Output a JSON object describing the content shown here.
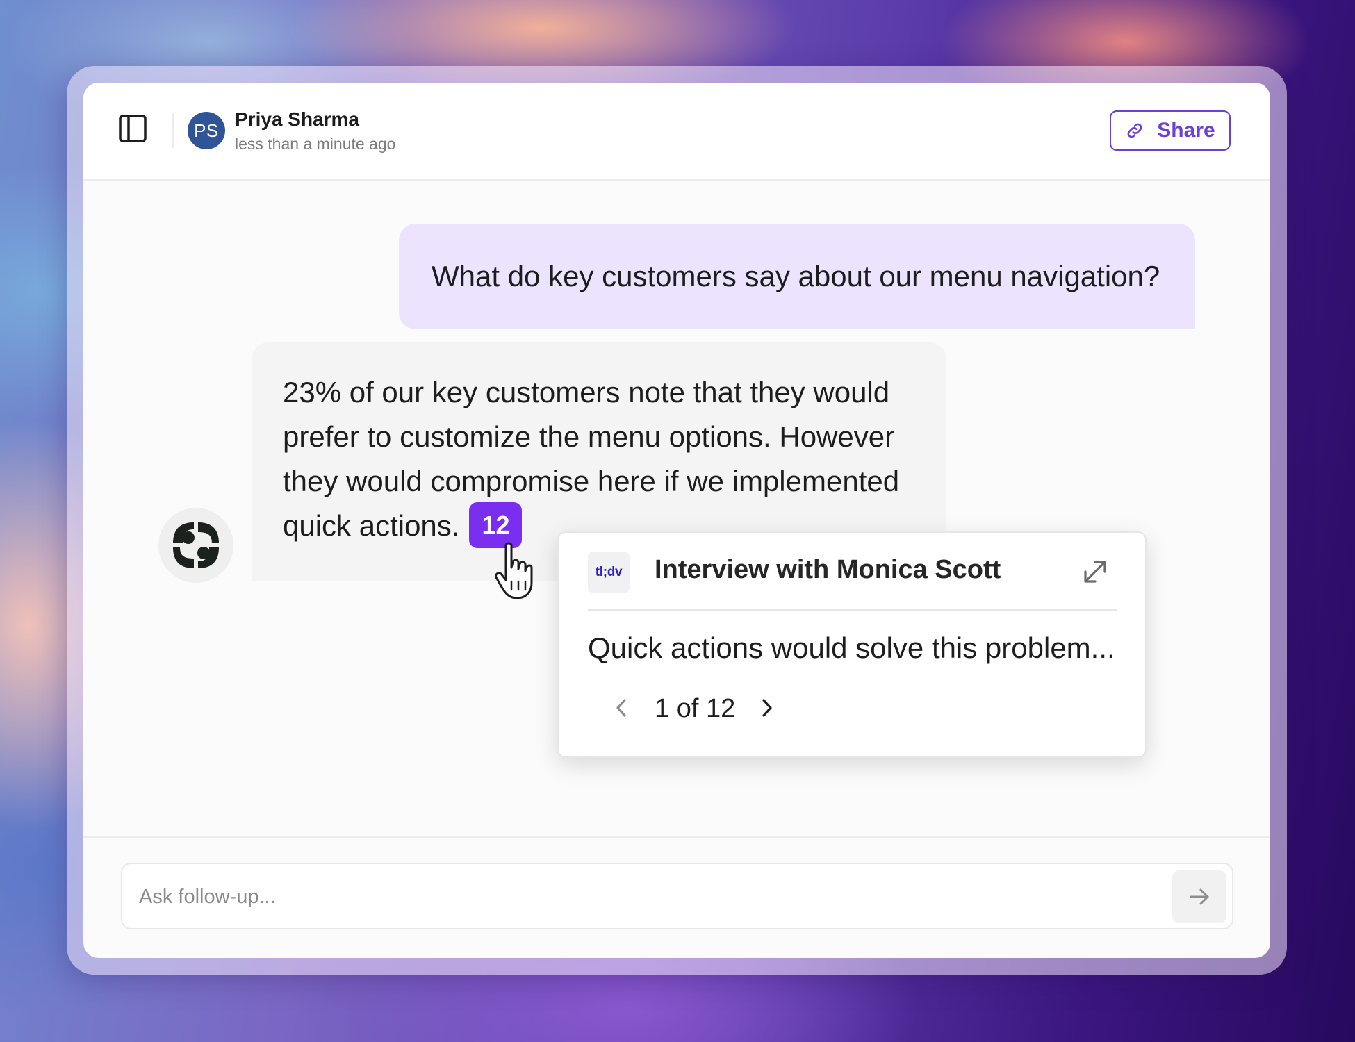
{
  "header": {
    "user": {
      "initials": "PS",
      "name": "Priya Sharma",
      "timestamp": "less than a minute ago",
      "avatar_color": "#2f5597"
    },
    "share_label": "Share",
    "icons": [
      "sidebar-toggle-icon",
      "link-icon"
    ]
  },
  "conversation": {
    "user_message": "What do key customers say about our menu navigation?",
    "assistant_message": "23% of our key customers note that they would prefer to customize the menu options. However they would compromise here if we implemented quick actions.",
    "citation_count": "12"
  },
  "source_popover": {
    "source_logo": "tl;dv",
    "title": "Interview with Monica Scott",
    "quote": "Quick actions would solve this problem...",
    "page_indicator": "1 of 12",
    "icons": [
      "expand-icon",
      "chevron-left-icon",
      "chevron-right-icon"
    ]
  },
  "composer": {
    "placeholder": "Ask follow-up...",
    "value": "",
    "icons": [
      "arrow-right-icon"
    ]
  },
  "colors": {
    "accent": "#6b3fd8",
    "citation_badge": "#7a2ff0",
    "user_bubble": "#ece4fe",
    "assistant_bubble": "#f4f4f4"
  }
}
